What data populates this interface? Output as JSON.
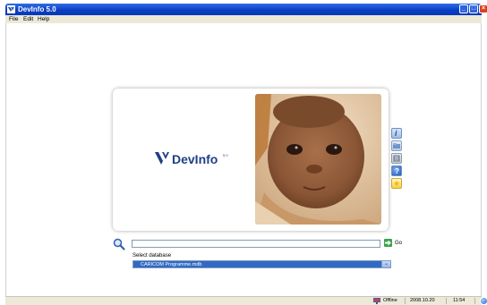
{
  "window": {
    "title": "DevInfo 5.0",
    "app_icon": "devinfo-app-icon",
    "controls": [
      "minimize-icon",
      "maximize-icon",
      "close-icon"
    ]
  },
  "menu": {
    "items": [
      {
        "label": "File"
      },
      {
        "label": "Edit"
      },
      {
        "label": "Help"
      }
    ]
  },
  "splash": {
    "logo_text": "DevInfo",
    "logo_tm": "5.0",
    "side_icons": [
      "info-icon",
      "folder-icon",
      "database-icon",
      "help-icon",
      "star-icon"
    ]
  },
  "search": {
    "value": "",
    "go_label": "Go"
  },
  "database": {
    "label": "Select database",
    "selected": "CARICOM Programme.mdb"
  },
  "status": {
    "connection": "Offline",
    "date": "2008.10.20",
    "time": "11:54"
  },
  "colors": {
    "titlebar": "#0a3fc4",
    "select_bg": "#316ac5",
    "logo": "#1f3f87",
    "chrome": "#ece9d8"
  }
}
